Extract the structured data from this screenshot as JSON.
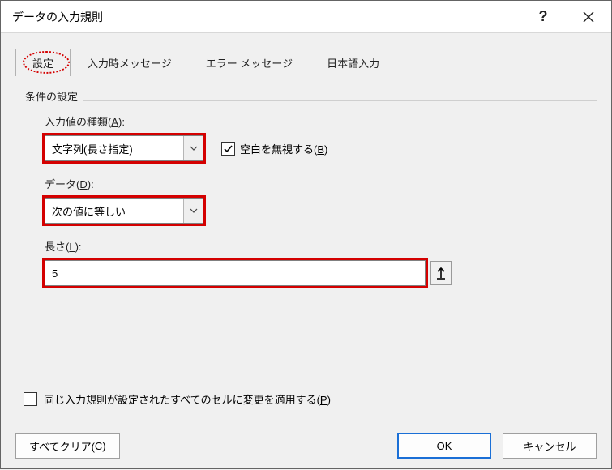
{
  "title": "データの入力規則",
  "tabs": {
    "settings": "設定",
    "input_message": "入力時メッセージ",
    "error_message": "エラー メッセージ",
    "ime": "日本語入力"
  },
  "group": {
    "label": "条件の設定"
  },
  "allow": {
    "label_pre": "入力値の種類(",
    "label_accel": "A",
    "label_post": "):",
    "value": "文字列(長さ指定)"
  },
  "ignore_blank": {
    "checked": true,
    "label_pre": "空白を無視する(",
    "label_accel": "B",
    "label_post": ")"
  },
  "data_op": {
    "label_pre": "データ(",
    "label_accel": "D",
    "label_post": "):",
    "value": "次の値に等しい"
  },
  "length": {
    "label_pre": "長さ(",
    "label_accel": "L",
    "label_post": "):",
    "value": "5"
  },
  "apply_all": {
    "checked": false,
    "label_pre": "同じ入力規則が設定されたすべてのセルに変更を適用する(",
    "label_accel": "P",
    "label_post": ")"
  },
  "buttons": {
    "clear_pre": "すべてクリア(",
    "clear_accel": "C",
    "clear_post": ")",
    "ok": "OK",
    "cancel": "キャンセル"
  }
}
